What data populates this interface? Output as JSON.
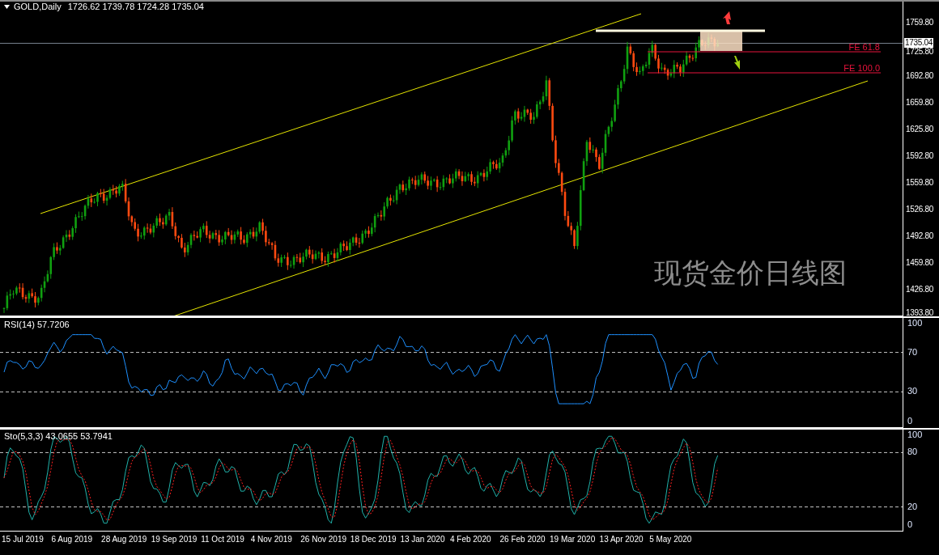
{
  "chart_header": {
    "symbol": "GOLD,Daily",
    "ohlc": "1726.62 1739.78 1724.28 1735.04"
  },
  "price_axis": {
    "ticks": [
      "1759.80",
      "1725.80",
      "1692.80",
      "1659.80",
      "1625.80",
      "1592.80",
      "1559.80",
      "1526.80",
      "1492.80",
      "1459.80",
      "1426.80",
      "1393.80"
    ],
    "current_price": "1735.04"
  },
  "levels": [
    {
      "label": "FE 61.8"
    },
    {
      "label": "FE 100.0"
    }
  ],
  "caption": "现货金价日线图",
  "rsi_panel": {
    "label": "RSI(14) 57.7206",
    "ticks": [
      "100",
      "70",
      "30",
      "0"
    ]
  },
  "stochastic_panel": {
    "label": "Sto(5,3,3) 43.0655 53.7941",
    "ticks": [
      "100",
      "80",
      "20",
      "0"
    ]
  },
  "time_axis": {
    "labels": [
      "15 Jul 2019",
      "6 Aug 2019",
      "28 Aug 2019",
      "19 Sep 2019",
      "11 Oct 2019",
      "4 Nov 2019",
      "26 Nov 2019",
      "18 Dec 2019",
      "13 Jan 2020",
      "4 Feb 2020",
      "26 Feb 2020",
      "19 Mar 2020",
      "13 Apr 2020",
      "5 May 2020"
    ]
  }
}
